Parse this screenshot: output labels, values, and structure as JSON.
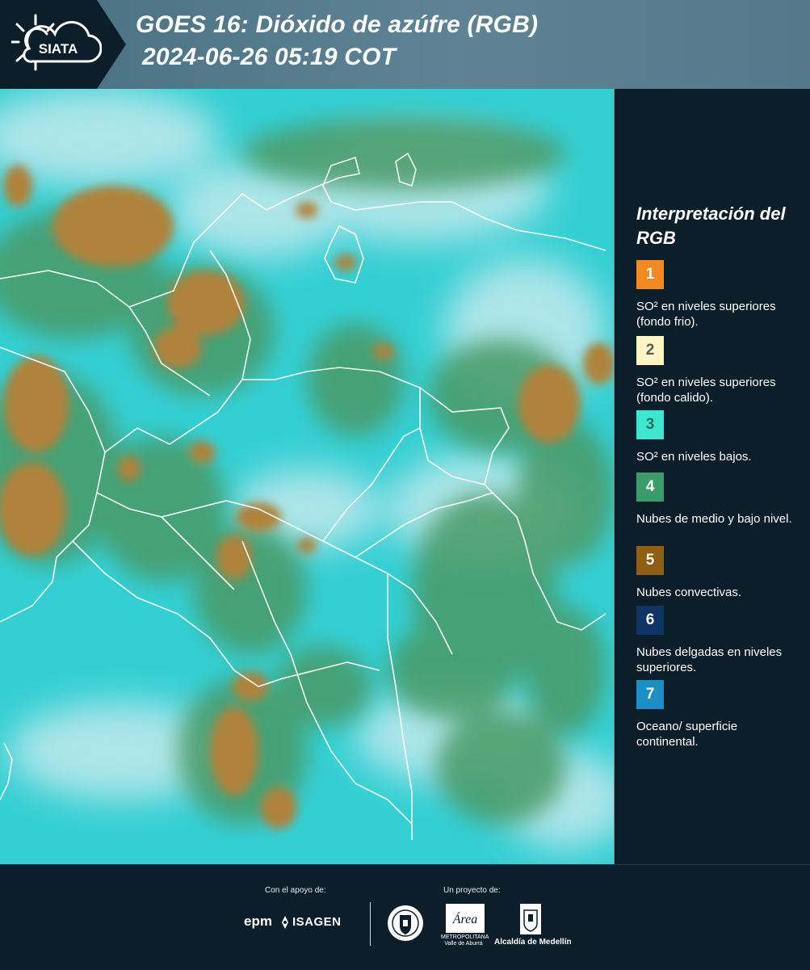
{
  "header": {
    "logo_text": "SIATA",
    "title_line1": "GOES 16: Dióxido de azúfre (RGB)",
    "title_line2": "2024-06-26 05:19 COT",
    "background": "#5d8394"
  },
  "map": {
    "product": "GOES 16 SO2 RGB",
    "colors": {
      "cyan_background": "#35d3d6",
      "green_clouds": "#4a9b6a",
      "convective_orange": "#b0833a",
      "thin_clouds_white": "#d9eef2",
      "borders": "#ffffff"
    }
  },
  "legend": {
    "title": "Interpretación del RGB",
    "items": [
      {
        "num": "1",
        "label": "SO² en niveles superiores (fondo frio).",
        "color": "#f28a1f",
        "num_color": "#ffffff"
      },
      {
        "num": "2",
        "label": "SO² en niveles superiores (fondo calido).",
        "color": "#fdf6c3",
        "num_color": "#5a5a5a"
      },
      {
        "num": "3",
        "label": "SO² en niveles bajos.",
        "color": "#3de6cf",
        "num_color": "#2a6b62"
      },
      {
        "num": "4",
        "label": "Nubes de medio y bajo nivel.",
        "color": "#3c9a6b",
        "num_color": "#ffffff"
      },
      {
        "num": "5",
        "label": "Nubes convectivas.",
        "color": "#8f5e12",
        "num_color": "#ffffff"
      },
      {
        "num": "6",
        "label": "Nubes delgadas en niveles superiores.",
        "color": "#0f3566",
        "num_color": "#ffffff"
      },
      {
        "num": "7",
        "label": "Oceano/ superficie continental.",
        "color": "#1b8fc3",
        "num_color": "#ffffff"
      }
    ]
  },
  "footer": {
    "support_label": "Con el apoyo de:",
    "project_label": "Un proyecto de:",
    "sponsor1": "epm",
    "sponsor2": "ISAGEN",
    "partner_amva": "Área",
    "partner_amva_sub": "METROPOLITANA Valle de Aburrá",
    "partner_alcaldia": "Alcaldía de Medellín"
  }
}
